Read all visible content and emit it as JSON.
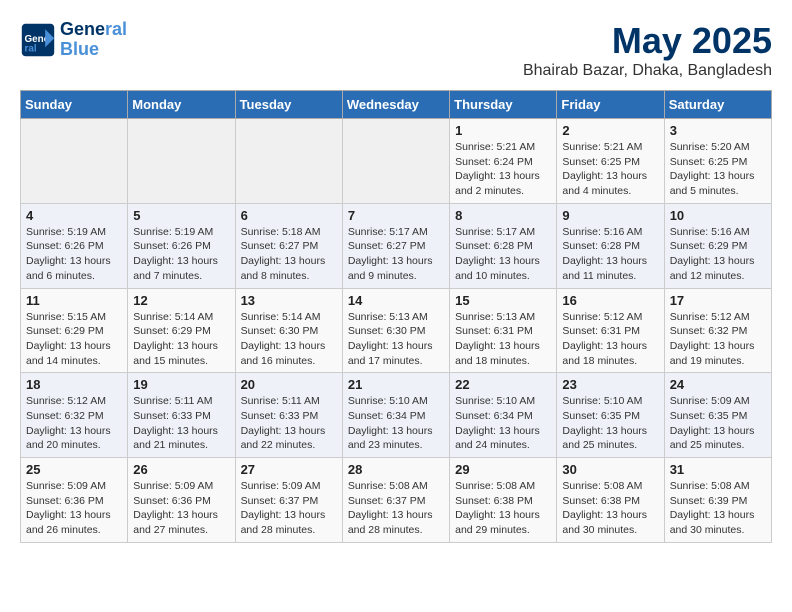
{
  "logo": {
    "line1": "General",
    "line2": "Blue"
  },
  "title": "May 2025",
  "subtitle": "Bhairab Bazar, Dhaka, Bangladesh",
  "headers": [
    "Sunday",
    "Monday",
    "Tuesday",
    "Wednesday",
    "Thursday",
    "Friday",
    "Saturday"
  ],
  "weeks": [
    [
      {
        "day": "",
        "detail": ""
      },
      {
        "day": "",
        "detail": ""
      },
      {
        "day": "",
        "detail": ""
      },
      {
        "day": "",
        "detail": ""
      },
      {
        "day": "1",
        "detail": "Sunrise: 5:21 AM\nSunset: 6:24 PM\nDaylight: 13 hours\nand 2 minutes."
      },
      {
        "day": "2",
        "detail": "Sunrise: 5:21 AM\nSunset: 6:25 PM\nDaylight: 13 hours\nand 4 minutes."
      },
      {
        "day": "3",
        "detail": "Sunrise: 5:20 AM\nSunset: 6:25 PM\nDaylight: 13 hours\nand 5 minutes."
      }
    ],
    [
      {
        "day": "4",
        "detail": "Sunrise: 5:19 AM\nSunset: 6:26 PM\nDaylight: 13 hours\nand 6 minutes."
      },
      {
        "day": "5",
        "detail": "Sunrise: 5:19 AM\nSunset: 6:26 PM\nDaylight: 13 hours\nand 7 minutes."
      },
      {
        "day": "6",
        "detail": "Sunrise: 5:18 AM\nSunset: 6:27 PM\nDaylight: 13 hours\nand 8 minutes."
      },
      {
        "day": "7",
        "detail": "Sunrise: 5:17 AM\nSunset: 6:27 PM\nDaylight: 13 hours\nand 9 minutes."
      },
      {
        "day": "8",
        "detail": "Sunrise: 5:17 AM\nSunset: 6:28 PM\nDaylight: 13 hours\nand 10 minutes."
      },
      {
        "day": "9",
        "detail": "Sunrise: 5:16 AM\nSunset: 6:28 PM\nDaylight: 13 hours\nand 11 minutes."
      },
      {
        "day": "10",
        "detail": "Sunrise: 5:16 AM\nSunset: 6:29 PM\nDaylight: 13 hours\nand 12 minutes."
      }
    ],
    [
      {
        "day": "11",
        "detail": "Sunrise: 5:15 AM\nSunset: 6:29 PM\nDaylight: 13 hours\nand 14 minutes."
      },
      {
        "day": "12",
        "detail": "Sunrise: 5:14 AM\nSunset: 6:29 PM\nDaylight: 13 hours\nand 15 minutes."
      },
      {
        "day": "13",
        "detail": "Sunrise: 5:14 AM\nSunset: 6:30 PM\nDaylight: 13 hours\nand 16 minutes."
      },
      {
        "day": "14",
        "detail": "Sunrise: 5:13 AM\nSunset: 6:30 PM\nDaylight: 13 hours\nand 17 minutes."
      },
      {
        "day": "15",
        "detail": "Sunrise: 5:13 AM\nSunset: 6:31 PM\nDaylight: 13 hours\nand 18 minutes."
      },
      {
        "day": "16",
        "detail": "Sunrise: 5:12 AM\nSunset: 6:31 PM\nDaylight: 13 hours\nand 18 minutes."
      },
      {
        "day": "17",
        "detail": "Sunrise: 5:12 AM\nSunset: 6:32 PM\nDaylight: 13 hours\nand 19 minutes."
      }
    ],
    [
      {
        "day": "18",
        "detail": "Sunrise: 5:12 AM\nSunset: 6:32 PM\nDaylight: 13 hours\nand 20 minutes."
      },
      {
        "day": "19",
        "detail": "Sunrise: 5:11 AM\nSunset: 6:33 PM\nDaylight: 13 hours\nand 21 minutes."
      },
      {
        "day": "20",
        "detail": "Sunrise: 5:11 AM\nSunset: 6:33 PM\nDaylight: 13 hours\nand 22 minutes."
      },
      {
        "day": "21",
        "detail": "Sunrise: 5:10 AM\nSunset: 6:34 PM\nDaylight: 13 hours\nand 23 minutes."
      },
      {
        "day": "22",
        "detail": "Sunrise: 5:10 AM\nSunset: 6:34 PM\nDaylight: 13 hours\nand 24 minutes."
      },
      {
        "day": "23",
        "detail": "Sunrise: 5:10 AM\nSunset: 6:35 PM\nDaylight: 13 hours\nand 25 minutes."
      },
      {
        "day": "24",
        "detail": "Sunrise: 5:09 AM\nSunset: 6:35 PM\nDaylight: 13 hours\nand 25 minutes."
      }
    ],
    [
      {
        "day": "25",
        "detail": "Sunrise: 5:09 AM\nSunset: 6:36 PM\nDaylight: 13 hours\nand 26 minutes."
      },
      {
        "day": "26",
        "detail": "Sunrise: 5:09 AM\nSunset: 6:36 PM\nDaylight: 13 hours\nand 27 minutes."
      },
      {
        "day": "27",
        "detail": "Sunrise: 5:09 AM\nSunset: 6:37 PM\nDaylight: 13 hours\nand 28 minutes."
      },
      {
        "day": "28",
        "detail": "Sunrise: 5:08 AM\nSunset: 6:37 PM\nDaylight: 13 hours\nand 28 minutes."
      },
      {
        "day": "29",
        "detail": "Sunrise: 5:08 AM\nSunset: 6:38 PM\nDaylight: 13 hours\nand 29 minutes."
      },
      {
        "day": "30",
        "detail": "Sunrise: 5:08 AM\nSunset: 6:38 PM\nDaylight: 13 hours\nand 30 minutes."
      },
      {
        "day": "31",
        "detail": "Sunrise: 5:08 AM\nSunset: 6:39 PM\nDaylight: 13 hours\nand 30 minutes."
      }
    ]
  ]
}
